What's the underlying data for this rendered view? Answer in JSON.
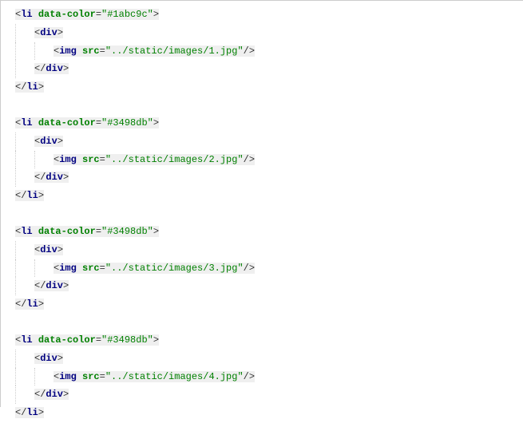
{
  "code_blocks": [
    {
      "open_tag": "li",
      "open_attr_name": "data-color",
      "open_attr_value": "\"#1abc9c\"",
      "div_open": "div",
      "img_tag": "img",
      "img_attr_name": "src",
      "img_attr_value": "\"../static/images/1.jpg\"",
      "div_close": "div",
      "li_close": "li"
    },
    {
      "open_tag": "li",
      "open_attr_name": "data-color",
      "open_attr_value": "\"#3498db\"",
      "div_open": "div",
      "img_tag": "img",
      "img_attr_name": "src",
      "img_attr_value": "\"../static/images/2.jpg\"",
      "div_close": "div",
      "li_close": "li"
    },
    {
      "open_tag": "li",
      "open_attr_name": "data-color",
      "open_attr_value": "\"#3498db\"",
      "div_open": "div",
      "img_tag": "img",
      "img_attr_name": "src",
      "img_attr_value": "\"../static/images/3.jpg\"",
      "div_close": "div",
      "li_close": "li"
    },
    {
      "open_tag": "li",
      "open_attr_name": "data-color",
      "open_attr_value": "\"#3498db\"",
      "div_open": "div",
      "img_tag": "img",
      "img_attr_name": "src",
      "img_attr_value": "\"../static/images/4.jpg\"",
      "div_close": "div",
      "li_close": "li"
    }
  ]
}
